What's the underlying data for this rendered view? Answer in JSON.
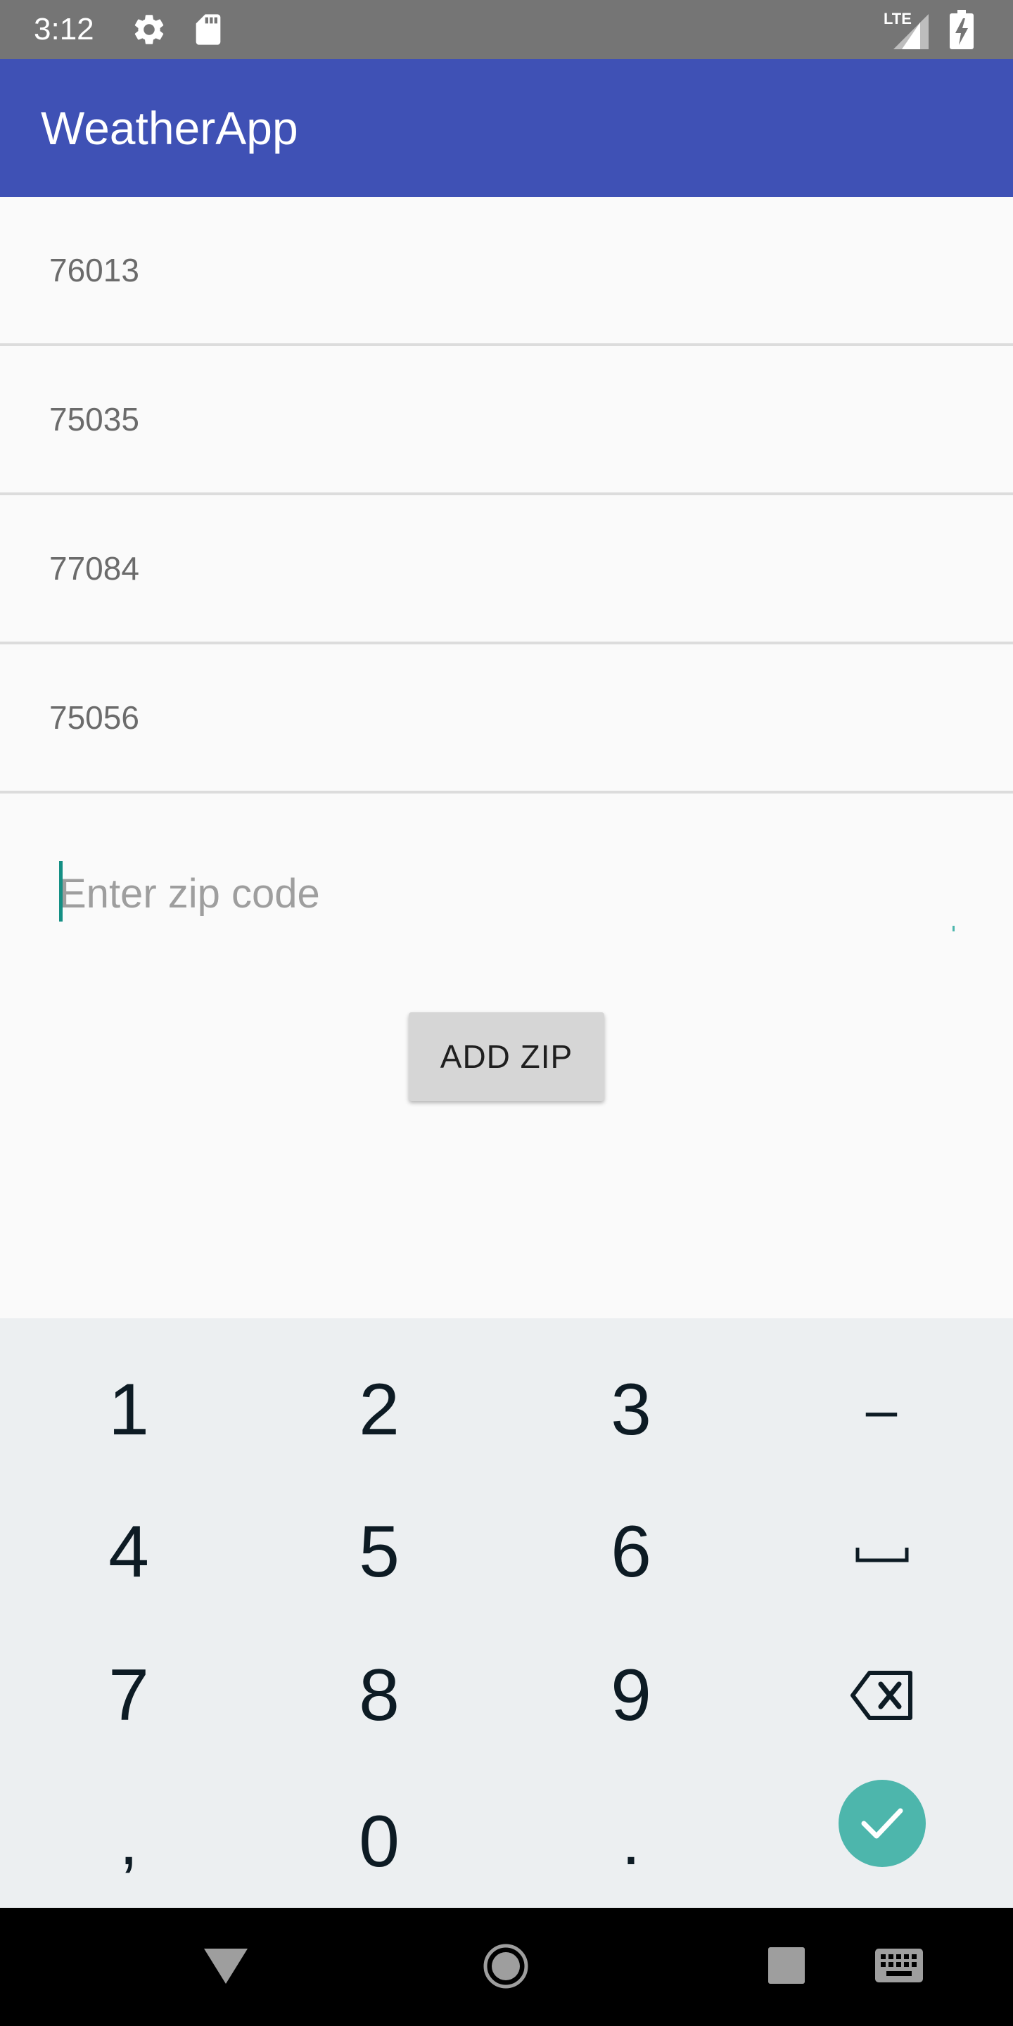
{
  "status_bar": {
    "time": "3:12",
    "icons": [
      "gear-icon",
      "sd-card-icon",
      "lte-signal-icon",
      "battery-charging-icon"
    ],
    "network_label": "LTE"
  },
  "app_bar": {
    "title": "WeatherApp",
    "color": "#3f51b5"
  },
  "zip_list": [
    {
      "zip": "76013"
    },
    {
      "zip": "75035"
    },
    {
      "zip": "77084"
    },
    {
      "zip": "75056"
    }
  ],
  "zip_input": {
    "value": "",
    "placeholder": "Enter zip code"
  },
  "add_button": {
    "label": "ADD ZIP"
  },
  "keyboard": {
    "keys": {
      "k1": "1",
      "k2": "2",
      "k3": "3",
      "dash": "–",
      "k4": "4",
      "k5": "5",
      "k6": "6",
      "k7": "7",
      "k8": "8",
      "k9": "9",
      "comma": ",",
      "k0": "0",
      "period": "."
    },
    "icons": [
      "space-icon",
      "backspace-icon",
      "checkmark-icon"
    ],
    "accent": "#4db6ac"
  },
  "nav_bar": {
    "icons": [
      "back-icon",
      "home-icon",
      "recents-icon",
      "keyboard-switch-icon"
    ]
  }
}
